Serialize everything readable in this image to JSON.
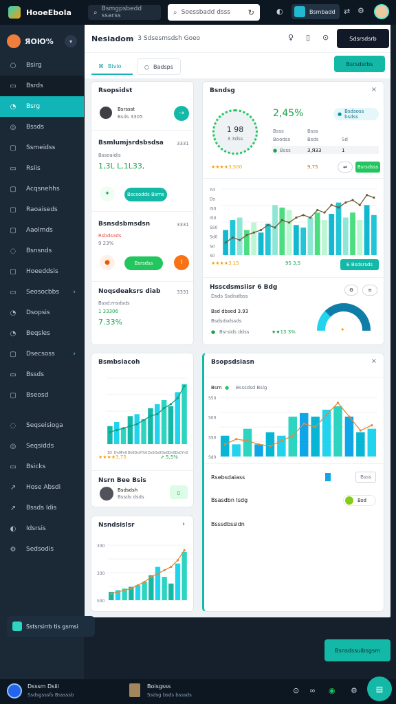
{
  "app": {
    "brand": "HooeEbola"
  },
  "topbar": {
    "search_dark": "Bsmgpsbedd ssarss",
    "search_light": "Soessbadd dsss",
    "chip_label": "Bsmbadd"
  },
  "sidebar": {
    "title": "ЯOЮ%",
    "items": [
      {
        "icon": "○",
        "label": "Bsirg"
      },
      {
        "icon": "▭",
        "label": "Bsrds"
      },
      {
        "icon": "◔",
        "label": "Bsrg"
      },
      {
        "icon": "◎",
        "label": "Bssds"
      },
      {
        "icon": "▢",
        "label": "Ssmeidss"
      },
      {
        "icon": "▭",
        "label": "Rsiis"
      },
      {
        "icon": "▢",
        "label": "Acqsnehhs"
      },
      {
        "icon": "▢",
        "label": "Raoaiseds"
      },
      {
        "icon": "▢",
        "label": "Aaolmds"
      },
      {
        "icon": "◌",
        "label": "Bsnsnds"
      },
      {
        "icon": "▢",
        "label": "Hoeeddsis"
      },
      {
        "icon": "▭",
        "label": "Seosocbbs"
      },
      {
        "icon": "◔",
        "label": "Dsopsis"
      },
      {
        "icon": "◔",
        "label": "Beqsles"
      },
      {
        "icon": "▢",
        "label": "Dsecsoss"
      },
      {
        "icon": "▭",
        "label": "Bssds"
      },
      {
        "icon": "▢",
        "label": "Bseosd"
      },
      {
        "icon": "◌",
        "label": "Seqseisioga"
      },
      {
        "icon": "◎",
        "label": "Seqsidds"
      },
      {
        "icon": "▭",
        "label": "Bsicks"
      },
      {
        "icon": "↗",
        "label": "Hose Absdi"
      },
      {
        "icon": "↗",
        "label": "Bssds Idis"
      },
      {
        "icon": "◐",
        "label": "Idsrsis"
      },
      {
        "icon": "⚙",
        "label": "Sedsodis"
      }
    ],
    "cta": "Sstsrsirrb tis gsmsi"
  },
  "main": {
    "title": "Nesiadom",
    "subtitle": "3 Sdsesmsdsh Goeo",
    "header_button": "Sdsrsdsrb",
    "tabs": [
      "Bivio",
      "Badsps"
    ],
    "tab_action": "Bsrsdsrbs"
  },
  "cards": {
    "c1_title": "Rsopsidst",
    "c1_person": "Bsrssst",
    "c1_person_sub": "Bsds 3305",
    "c2_title": "Bsmlumjsrdsbsdsa",
    "c2_tag": "3331",
    "c2_sub": "Bssoaidis",
    "c2_value": "1,3L L,1L33,",
    "c2_btn": "Bscsodds Bsms",
    "c3_title": "Bsnsdsbmsdsn",
    "c3_tag": "3331",
    "c3_sub": "Rsbdsads",
    "c3_val": "9 23%",
    "c3_btn": "Bsrsdss",
    "c4_title": "Noqsdeaksrs diab",
    "c4_tag": "3331",
    "c4_sub": "Bssd:msdsds",
    "c4_val": "1 33306",
    "c4_pct": "7.33%"
  },
  "right_top": {
    "title": "Bsndsg",
    "gauge_val": "1 98",
    "gauge_sub": "3 3dss",
    "headline": "2,45%",
    "chip": "Bsdsoss bsdss",
    "table": [
      [
        "Bsss",
        "Bsss"
      ],
      [
        "Boodss",
        "Bsds",
        "Sd"
      ],
      [
        "Bsss",
        "3,Я33",
        "1"
      ]
    ],
    "foot_val": "9,75",
    "stars_val": "3,500",
    "btn": "Bsrsdsss",
    "chart_label": "Bssdss dsdg",
    "chart_stars": "3.15",
    "chart_pct": "95 3,5",
    "chart_btn": "Б Bsdsrsds",
    "section_title": "Hsscdsmsiisr 6 Bdg",
    "section_sub": "Dsds Ssdisdbss",
    "row_label": "Bsd dbsed 3.93",
    "row_sub": "Bsdsdsdssds",
    "legend_a": "Bsrsids ddss",
    "legend_b": "13.3%"
  },
  "left_bottom": {
    "title": "Bsmbsiacoh",
    "stars_val": "3,75",
    "pct": "5,5%",
    "person_head": "Nsrn Bee Bsis",
    "person": "Bsdsdsh",
    "person_sub": "Bssds dsds"
  },
  "left_bottom2": {
    "title": "Nsndsislsr"
  },
  "right_bottom": {
    "title": "Bsopsdsiasn",
    "legend": "Bsssdsd Bslg",
    "row1": "Rsebsdaiass",
    "row1_btn": "Bsss",
    "row2": "Bsasdbn Isdg",
    "row2_val": "Bsd",
    "row3": "Bsssdbssidn"
  },
  "cta_right": "Bsnsdssuibsgsm",
  "bottombar": {
    "name": "Dsssm Dsiii",
    "name_sub": "Ssdsgsssfs Bsssssb",
    "item_title": "Boisgsss",
    "item_sub": "Ssdsg bsds bsssds"
  },
  "chart_data": [
    {
      "type": "bar",
      "categories": [
        "1",
        "2",
        "3",
        "4",
        "5",
        "6",
        "7",
        "8",
        "9",
        "10",
        "11",
        "12",
        "13",
        "14",
        "15",
        "16",
        "17",
        "18",
        "19",
        "20",
        "21",
        "22"
      ],
      "values": [
        20,
        28,
        30,
        20,
        26,
        18,
        25,
        40,
        38,
        36,
        24,
        22,
        30,
        34,
        28,
        33,
        42,
        30,
        34,
        28,
        40,
        32
      ],
      "series": [
        {
          "values": [
            10,
            14,
            12,
            16,
            18,
            20,
            24,
            22,
            28,
            26,
            30,
            32,
            30,
            36,
            34,
            40,
            38,
            42,
            44,
            40,
            48,
            46
          ]
        }
      ],
      "ylabels": [
        "Yd",
        "Ds",
        "IS0",
        "IS0",
        "SS0",
        "Sd0",
        "S0",
        "S0"
      ]
    },
    {
      "type": "bar",
      "categories": [
        "1",
        "2",
        "3",
        "4",
        "5",
        "6",
        "7",
        "8",
        "9",
        "10",
        "11",
        "12"
      ],
      "values": [
        18,
        22,
        16,
        28,
        30,
        25,
        36,
        40,
        44,
        38,
        52,
        60
      ],
      "series": [
        {
          "values": [
            12,
            14,
            16,
            18,
            20,
            24,
            28,
            30,
            36,
            40,
            46,
            58
          ]
        }
      ],
      "xlabels": [
        "1D",
        "Dn0",
        "Pn0",
        "Dk0",
        "Ds0",
        "Yk0",
        "Ds0",
        "Ds0",
        "De0",
        "Dn0",
        "Ds0",
        "Yn0"
      ]
    },
    {
      "type": "bar",
      "categories": [
        "1",
        "2",
        "3",
        "4",
        "5",
        "6",
        "7",
        "8",
        "9",
        "10",
        "11",
        "12",
        "13",
        "14"
      ],
      "values": [
        24,
        14,
        32,
        14,
        28,
        24,
        46,
        50,
        46,
        54,
        58,
        46,
        28,
        32
      ],
      "series": [
        {
          "values": [
            14,
            20,
            18,
            14,
            12,
            18,
            24,
            38,
            34,
            48,
            62,
            46,
            30,
            36
          ]
        }
      ],
      "ylabels": [
        "S50",
        "S00",
        "SS0",
        "Sd0"
      ]
    },
    {
      "type": "bar",
      "categories": [
        "1",
        "2",
        "3",
        "4",
        "5",
        "6",
        "7",
        "8",
        "9",
        "10",
        "11",
        "12"
      ],
      "values": [
        10,
        12,
        14,
        16,
        18,
        22,
        30,
        40,
        28,
        20,
        44,
        58
      ],
      "series": [
        {
          "values": [
            8,
            10,
            12,
            14,
            18,
            22,
            28,
            32,
            36,
            40,
            48,
            60
          ]
        }
      ],
      "ylabels": [
        "330",
        "330",
        "S30"
      ]
    }
  ],
  "colors": {
    "accent": "#14b8a6",
    "green": "#22c55e",
    "orange": "#f59e0b",
    "line": "#e08a3c"
  }
}
